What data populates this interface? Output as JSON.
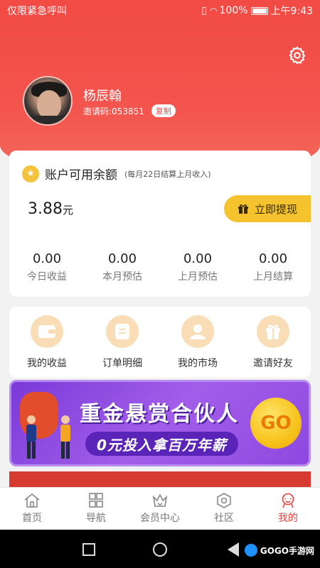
{
  "status_bar": {
    "left": "仅限紧急呼叫",
    "battery": "100%",
    "time": "上午9:43"
  },
  "profile": {
    "name": "杨辰翰",
    "invite_label": "邀请码:053851",
    "copy_label": "复制"
  },
  "balance": {
    "title": "账户可用余额",
    "note": "(每月22日结算上月收入)",
    "amount": "3.88",
    "unit": "元",
    "withdraw_label": "立即提现",
    "stats": [
      {
        "value": "0.00",
        "label": "今日收益"
      },
      {
        "value": "0.00",
        "label": "本月预估"
      },
      {
        "value": "0.00",
        "label": "上月预估"
      },
      {
        "value": "0.00",
        "label": "上月结算"
      }
    ]
  },
  "menu": [
    {
      "label": "我的收益",
      "icon": "wallet-icon"
    },
    {
      "label": "订单明细",
      "icon": "list-icon"
    },
    {
      "label": "我的市场",
      "icon": "people-icon"
    },
    {
      "label": "邀请好友",
      "icon": "gift-icon"
    }
  ],
  "banner": {
    "title": "重金悬赏合伙人",
    "subtitle": "0元投入拿百万年薪",
    "go": "GO"
  },
  "tabs": [
    {
      "label": "首页",
      "icon": "home-icon"
    },
    {
      "label": "导航",
      "icon": "grid-icon"
    },
    {
      "label": "会员中心",
      "icon": "crown-icon"
    },
    {
      "label": "社区",
      "icon": "community-icon"
    },
    {
      "label": "我的",
      "icon": "profile-icon"
    }
  ],
  "watermark": "GOGO手游网",
  "colors": {
    "primary_red": "#f24a45",
    "accent_yellow": "#f5c32d",
    "active_tab": "#e8423a"
  }
}
